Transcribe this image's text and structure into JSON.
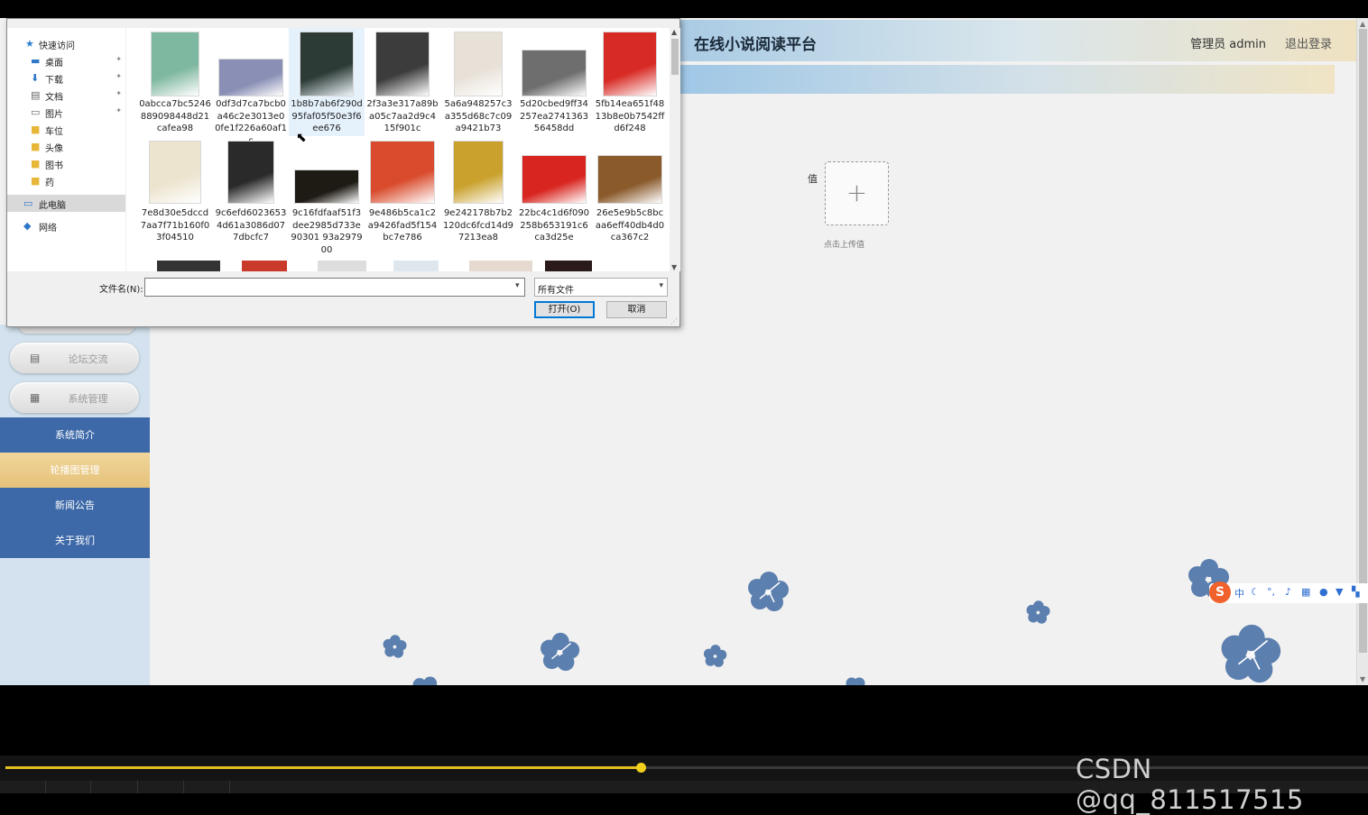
{
  "header": {
    "title": "在线小说阅读平台",
    "admin_label": "管理员 admin",
    "logout_label": "退出登录"
  },
  "sidebar": {
    "menu": [
      {
        "label": "论坛交流",
        "icon": "clipboard-icon"
      },
      {
        "label": "系统管理",
        "icon": "grid-icon"
      }
    ],
    "subitems": [
      {
        "label": "系统简介",
        "active": false
      },
      {
        "label": "轮播图管理",
        "active": true
      },
      {
        "label": "新闻公告",
        "active": false
      },
      {
        "label": "关于我们",
        "active": false
      }
    ]
  },
  "upload": {
    "field_label": "值",
    "hint": "点击上传值"
  },
  "dialog": {
    "nav": [
      {
        "label": "快速访问",
        "icon": "star-icon"
      },
      {
        "label": "桌面",
        "icon": "desktop-icon",
        "pinned": true
      },
      {
        "label": "下载",
        "icon": "download-icon",
        "pinned": true
      },
      {
        "label": "文档",
        "icon": "document-icon",
        "pinned": true
      },
      {
        "label": "图片",
        "icon": "pictures-icon",
        "pinned": true
      },
      {
        "label": "车位",
        "icon": "folder-icon"
      },
      {
        "label": "头像",
        "icon": "folder-icon"
      },
      {
        "label": "图书",
        "icon": "folder-icon"
      },
      {
        "label": "药",
        "icon": "folder-icon"
      },
      {
        "label": "此电脑",
        "icon": "computer-icon",
        "selected": true
      },
      {
        "label": "网络",
        "icon": "network-icon"
      }
    ],
    "files_row1": [
      {
        "name": "0abcca7bc5246889098448d21cafea98",
        "color": "#7fb8a0"
      },
      {
        "name": "0df3d7ca7bcb0a46c2e3013e00fe1f226a60af1c",
        "color": "#8a8fb5"
      },
      {
        "name": "1b8b7ab6f290d95faf05f50e3f6ee676",
        "color": "#2d3b36"
      },
      {
        "name": "2f3a3e317a89ba05c7aa2d9c415f901c",
        "color": "#3c3c3c"
      },
      {
        "name": "5a6a948257c3a355d68c7c09a9421b73",
        "color": "#e8e1d8"
      },
      {
        "name": "5d20cbed9ff34257ea274136356458dd",
        "color": "#6e6e6e"
      },
      {
        "name": "5fb14ea651f4813b8e0b7542ffd6f248",
        "color": "#d82a24"
      }
    ],
    "files_row2": [
      {
        "name": "7e8d30e5dccd7aa7f71b160f03f04510",
        "color": "#ede4cf"
      },
      {
        "name": "9c6efd60236534d61a3086d077dbcfc7",
        "color": "#2a2a2a"
      },
      {
        "name": "9c16fdfaaf51f3dee2985d733e90301 93a297900",
        "color": "#1e1a14"
      },
      {
        "name": "9e486b5ca1c2a9426fad5f154bc7e786",
        "color": "#d94b2c"
      },
      {
        "name": "9e242178b7b2120dc6fcd14d97213ea8",
        "color": "#c9a12c"
      },
      {
        "name": "22bc4c1d6f090258b653191c6ca3d25e",
        "color": "#d9251f"
      },
      {
        "name": "26e5e9b5c8bcaa6eff40db4d0ca367c2",
        "color": "#8a5a2b"
      }
    ],
    "filename_label": "文件名(N):",
    "filename_value": "",
    "filetype_value": "所有文件",
    "open_label": "打开(O)",
    "cancel_label": "取消"
  },
  "ime": {
    "logo": "S",
    "mode": "中"
  },
  "player": {
    "progress": 0.466
  },
  "watermark": "CSDN @qq_811517515"
}
